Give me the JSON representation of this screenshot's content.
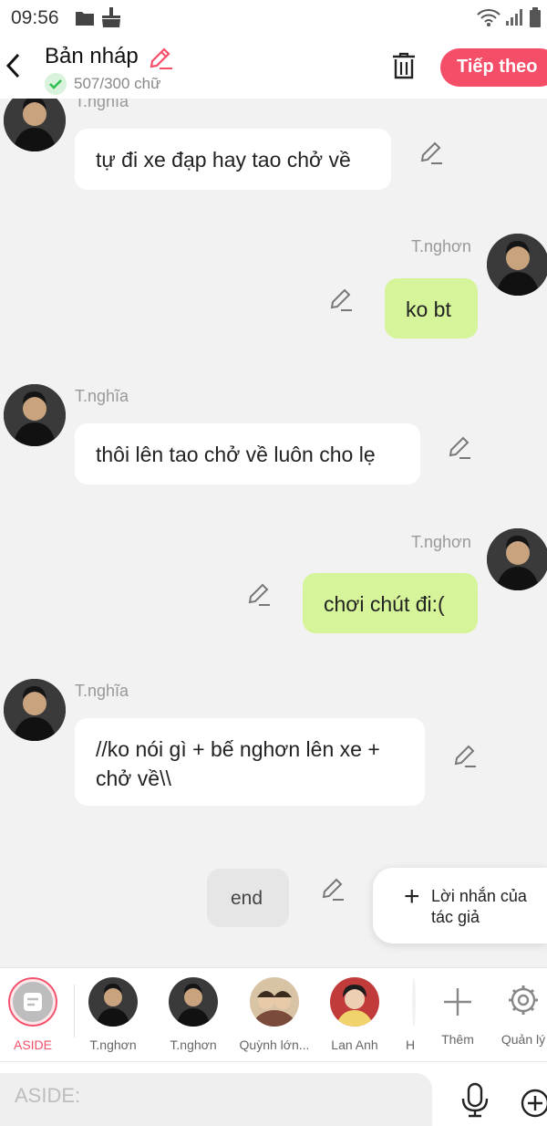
{
  "status_bar": {
    "time": "09:56"
  },
  "header": {
    "title": "Bản nháp",
    "word_count": "507/300 chữ",
    "next_label": "Tiếp theo"
  },
  "messages": [
    {
      "sender": "T.nghĩa",
      "side": "left",
      "text": "tự đi xe đạp hay tao chở về"
    },
    {
      "sender": "T.nghơn",
      "side": "right",
      "text": "ko bt"
    },
    {
      "sender": "T.nghĩa",
      "side": "left",
      "text": "thôi lên tao chở về luôn cho lẹ"
    },
    {
      "sender": "T.nghơn",
      "side": "right",
      "text": "chơi chút đi:("
    },
    {
      "sender": "T.nghĩa",
      "side": "left",
      "text": "//ko nói gì + bế nghơn lên xe + chở về\\\\"
    },
    {
      "sender": "",
      "side": "center",
      "text": "end"
    }
  ],
  "author_note": {
    "label": "Lời nhắn của tác giả"
  },
  "character_bar": {
    "aside": "ASIDE",
    "characters": [
      "T.nghơn",
      "T.nghơn",
      "Quỳnh lớn...",
      "Lan Anh",
      "H"
    ],
    "add_label": "Thêm",
    "manage_label": "Quản lý"
  },
  "input": {
    "placeholder": "ASIDE:"
  },
  "colors": {
    "accent": "#f44e69",
    "right_bubble": "#d6f59a",
    "background": "#f2f2f2"
  },
  "icons": [
    "folder-icon",
    "cleaner-icon",
    "wifi-icon",
    "signal-icon",
    "battery-icon",
    "back-icon",
    "pencil-icon",
    "check-icon",
    "trash-icon",
    "plus-icon",
    "gear-icon",
    "mic-icon",
    "add-circle-icon"
  ]
}
